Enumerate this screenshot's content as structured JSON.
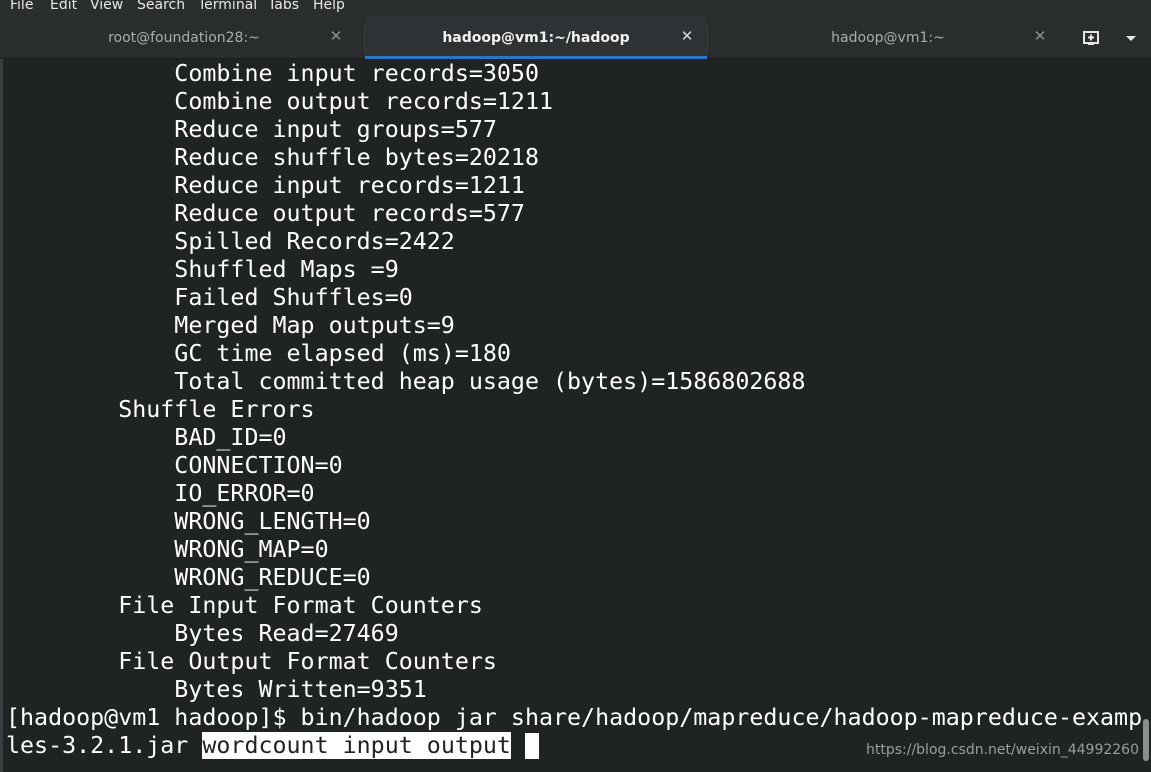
{
  "menu": [
    "File",
    "Edit",
    "View",
    "Search",
    "Terminal",
    "Tabs",
    "Help"
  ],
  "tabs": [
    {
      "label": "root@foundation28:~",
      "active": false
    },
    {
      "label": "hadoop@vm1:~/hadoop",
      "active": true
    },
    {
      "label": "hadoop@vm1:~",
      "active": false
    }
  ],
  "icons": {
    "tab_close": "close-icon",
    "new_tab": "new-tab-icon",
    "tab_menu": "chevron-down-icon"
  },
  "colors": {
    "background": "#1f2324",
    "text": "#ffffff",
    "accent": "#2a76c6"
  },
  "terminal": {
    "lines": [
      "            Combine input records=3050",
      "            Combine output records=1211",
      "            Reduce input groups=577",
      "            Reduce shuffle bytes=20218",
      "            Reduce input records=1211",
      "            Reduce output records=577",
      "            Spilled Records=2422",
      "            Shuffled Maps =9",
      "            Failed Shuffles=0",
      "            Merged Map outputs=9",
      "            GC time elapsed (ms)=180",
      "            Total committed heap usage (bytes)=1586802688",
      "        Shuffle Errors",
      "            BAD_ID=0",
      "            CONNECTION=0",
      "            IO_ERROR=0",
      "            WRONG_LENGTH=0",
      "            WRONG_MAP=0",
      "            WRONG_REDUCE=0",
      "        File Input Format Counters",
      "            Bytes Read=27469",
      "        File Output Format Counters",
      "            Bytes Written=9351",
      "[hadoop@vm1 hadoop]$ bin/hadoop jar share/hadoop/mapreduce/hadoop-mapreduce-examp"
    ],
    "last_line_prefix": "les-3.2.1.jar ",
    "selected_text": "wordcount input output"
  },
  "watermark": "https://blog.csdn.net/weixin_44992260"
}
